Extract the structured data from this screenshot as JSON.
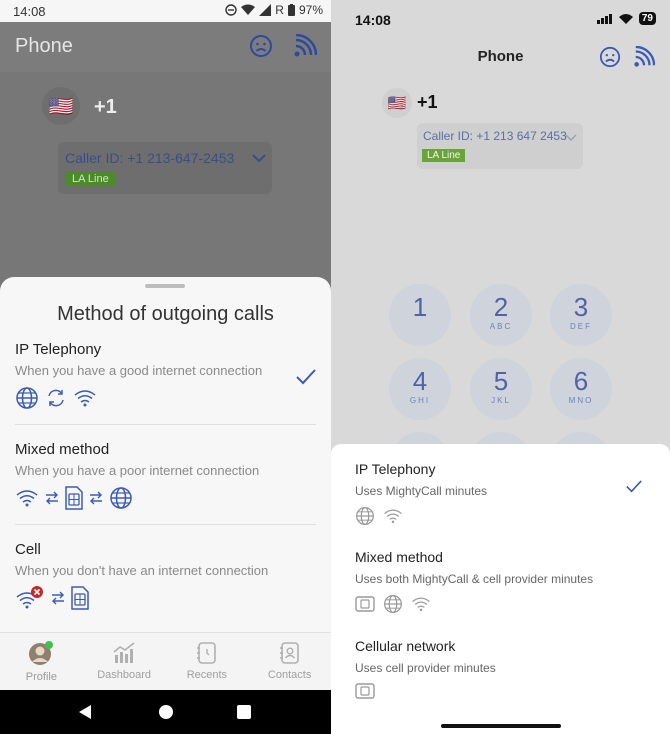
{
  "android": {
    "status": {
      "time": "14:08",
      "battery": "97%",
      "roaming": "R"
    },
    "title": "Phone",
    "dialer": {
      "flag": "🇺🇸",
      "code": "+1",
      "caller_id": "Caller ID: +1 213-647-2453",
      "line_badge": "LA Line"
    },
    "sheet": {
      "title": "Method of outgoing calls",
      "options": [
        {
          "name": "IP Telephony",
          "desc": "When you have a good internet connection",
          "selected": true
        },
        {
          "name": "Mixed method",
          "desc": "When you have a poor internet connection",
          "selected": false
        },
        {
          "name": "Cell",
          "desc": "When you don't have an internet connection",
          "selected": false
        }
      ]
    },
    "nav": [
      {
        "label": "Profile"
      },
      {
        "label": "Dashboard"
      },
      {
        "label": "Recents"
      },
      {
        "label": "Contacts"
      }
    ]
  },
  "ios": {
    "status": {
      "time": "14:08",
      "battery": "79"
    },
    "title": "Phone",
    "dialer": {
      "flag": "🇺🇸",
      "code": "+1",
      "caller_id": "Caller ID: +1 213 647 2453",
      "line_badge": "LA Line"
    },
    "keypad": [
      {
        "num": "1",
        "letters": ""
      },
      {
        "num": "2",
        "letters": "ABC"
      },
      {
        "num": "3",
        "letters": "DEF"
      },
      {
        "num": "4",
        "letters": "GHI"
      },
      {
        "num": "5",
        "letters": "JKL"
      },
      {
        "num": "6",
        "letters": "MNO"
      }
    ],
    "sheet": {
      "options": [
        {
          "name": "IP Telephony",
          "desc": "Uses MightyCall minutes",
          "selected": true
        },
        {
          "name": "Mixed method",
          "desc": "Uses both MightyCall & cell provider minutes",
          "selected": false
        },
        {
          "name": "Cellular network",
          "desc": "Uses cell provider minutes",
          "selected": false
        }
      ]
    }
  },
  "colors": {
    "accent": "#3b5bb5",
    "badge_green": "#4b8b2a"
  }
}
